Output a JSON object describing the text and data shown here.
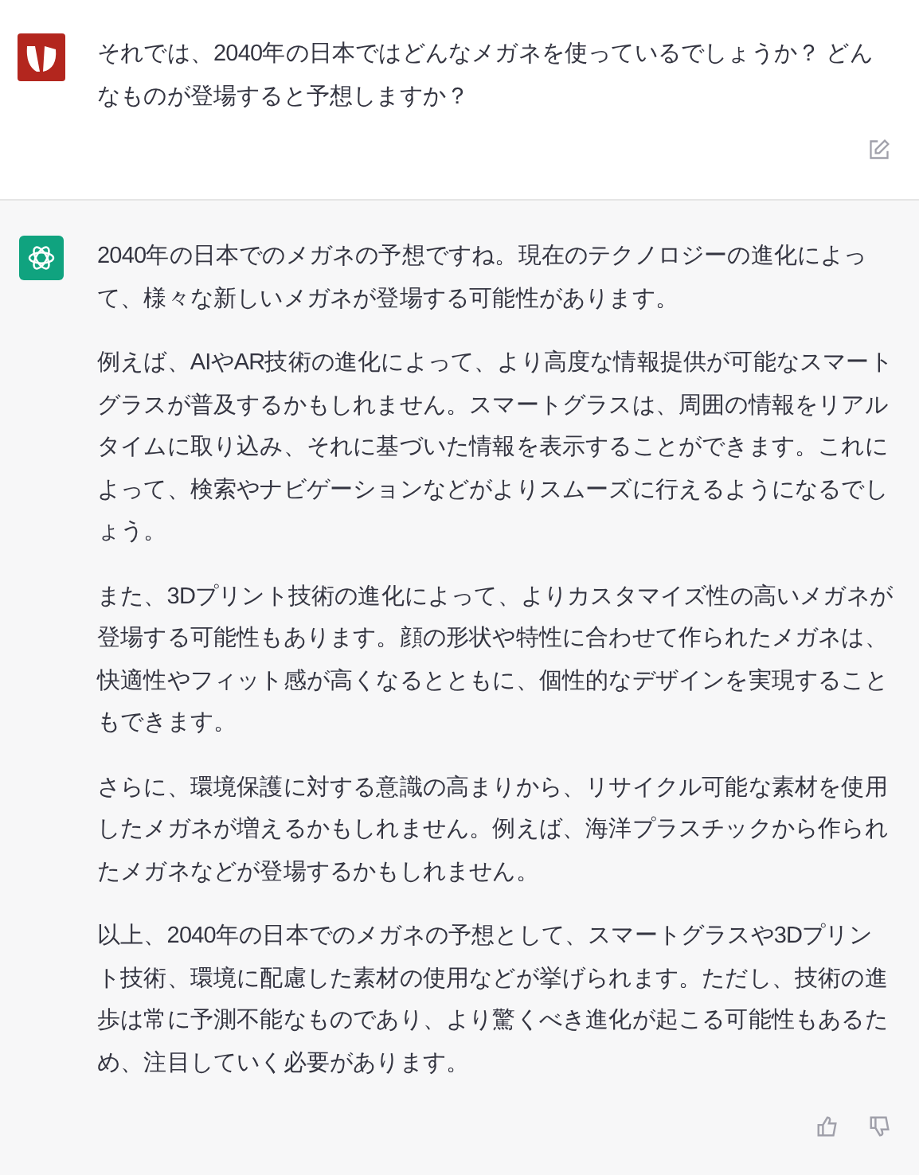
{
  "messages": [
    {
      "kind": "user",
      "paragraphs": [
        "それでは、2040年の日本ではどんなメガネを使っているでしょうか？ どんなものが登場すると予想しますか？"
      ]
    },
    {
      "kind": "assistant",
      "paragraphs": [
        "2040年の日本でのメガネの予想ですね。現在のテクノロジーの進化によって、様々な新しいメガネが登場する可能性があります。",
        "例えば、AIやAR技術の進化によって、より高度な情報提供が可能なスマートグラスが普及するかもしれません。スマートグラスは、周囲の情報をリアルタイムに取り込み、それに基づいた情報を表示することができます。これによって、検索やナビゲーションなどがよりスムーズに行えるようになるでしょう。",
        "また、3Dプリント技術の進化によって、よりカスタマイズ性の高いメガネが登場する可能性もあります。顔の形状や特性に合わせて作られたメガネは、快適性やフィット感が高くなるとともに、個性的なデザインを実現することもできます。",
        "さらに、環境保護に対する意識の高まりから、リサイクル可能な素材を使用したメガネが増えるかもしれません。例えば、海洋プラスチックから作られたメガネなどが登場するかもしれません。",
        "以上、2040年の日本でのメガネの予想として、スマートグラスや3Dプリント技術、環境に配慮した素材の使用などが挙げられます。ただし、技術の進歩は常に予測不能なものであり、より驚くべき進化が起こる可能性もあるため、注目していく必要があります。"
      ]
    }
  ]
}
